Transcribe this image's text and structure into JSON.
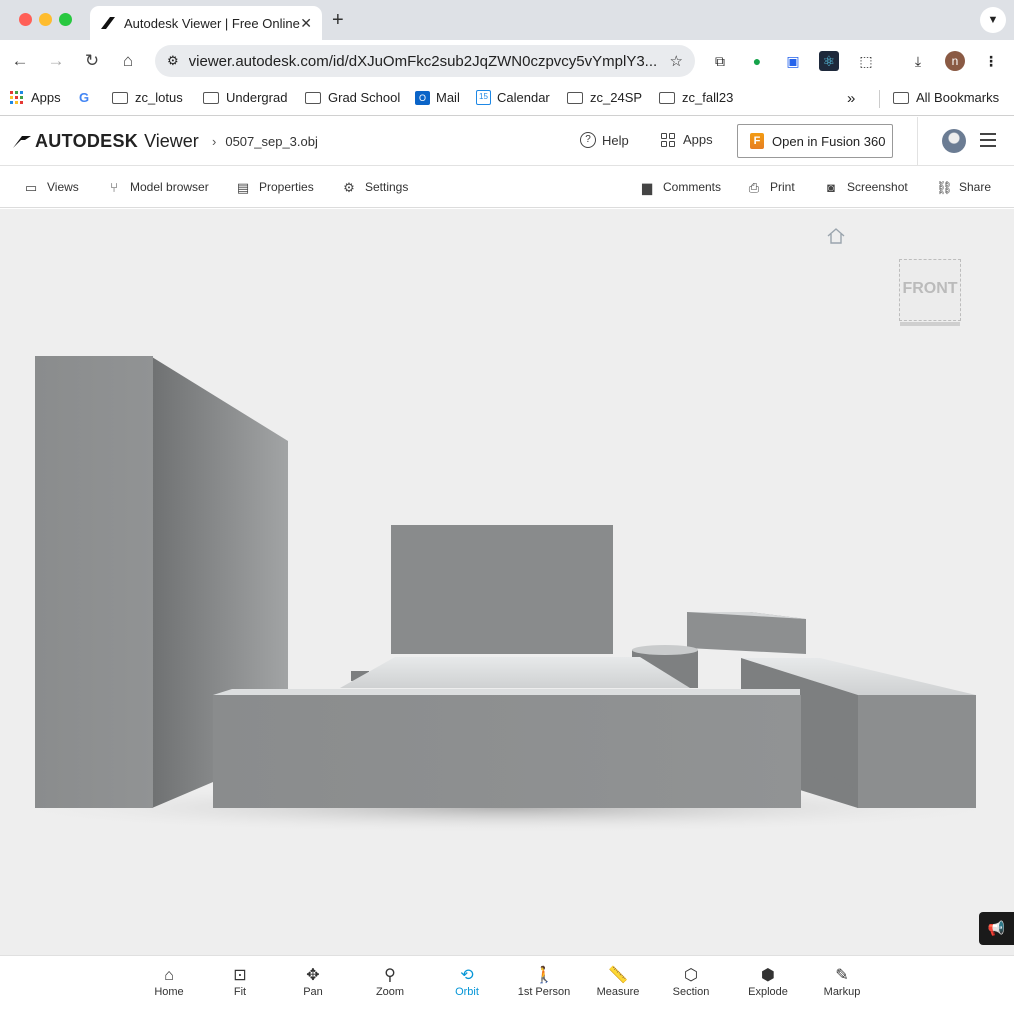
{
  "browser": {
    "tab_title": "Autodesk Viewer | Free Online",
    "url": "viewer.autodesk.com/id/dXJuOmFkc2sub2JqZWN0czpvcy5vYmplY3...",
    "profile_initial": "n",
    "bookmarks": [
      "Apps",
      "zc_lotus",
      "Undergrad",
      "Grad School",
      "Mail",
      "Calendar",
      "zc_24SP",
      "zc_fall23",
      "All Bookmarks"
    ],
    "calendar_day": "15"
  },
  "header": {
    "logo_brand": "AUTODESK",
    "logo_product": "Viewer",
    "file_name": "0507_sep_3.obj",
    "help_label": "Help",
    "apps_label": "Apps",
    "fusion_label": "Open in Fusion 360"
  },
  "subtoolbar": {
    "views": "Views",
    "model_browser": "Model browser",
    "properties": "Properties",
    "settings": "Settings",
    "comments": "Comments",
    "print": "Print",
    "screenshot": "Screenshot",
    "share": "Share"
  },
  "viewport": {
    "viewcube_face": "FRONT"
  },
  "bottom_toolbar": [
    {
      "label": "Home",
      "icon": "home-icon"
    },
    {
      "label": "Fit",
      "icon": "fit-icon"
    },
    {
      "label": "Pan",
      "icon": "pan-icon"
    },
    {
      "label": "Zoom",
      "icon": "zoom-icon"
    },
    {
      "label": "Orbit",
      "icon": "orbit-icon",
      "active": true
    },
    {
      "label": "1st Person",
      "icon": "person-icon"
    },
    {
      "label": "Measure",
      "icon": "measure-icon"
    },
    {
      "label": "Section",
      "icon": "section-icon"
    },
    {
      "label": "Explode",
      "icon": "explode-icon"
    },
    {
      "label": "Markup",
      "icon": "markup-icon"
    }
  ],
  "colors": {
    "accent": "#0696d7",
    "viewport_bg": "#eeeeee",
    "model_gray": "#8c8e8f"
  }
}
